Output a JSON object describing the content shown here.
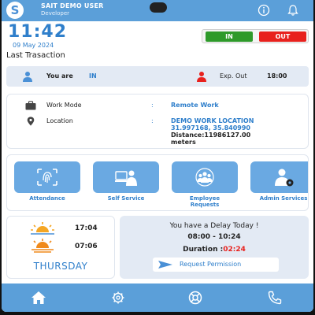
{
  "header": {
    "logo_letter": "S",
    "user_name": "SAIT DEMO USER",
    "user_role": "Developer",
    "icons": [
      "info-icon",
      "bell-icon"
    ]
  },
  "clock": {
    "time": "11:42",
    "date": "09 May 2024",
    "last_transaction_label": "Last Trasaction"
  },
  "punch": {
    "in_label": "IN",
    "out_label": "OUT",
    "in_color": "#2e9a2a",
    "out_color": "#e8211d"
  },
  "status": {
    "you_are_label": "You are",
    "you_are_value": "IN",
    "exp_out_label": "Exp. Out",
    "exp_out_value": "18:00"
  },
  "work": {
    "work_mode_label": "Work Mode",
    "work_mode_value": "Remote Work",
    "location_label": "Location",
    "colon": ":",
    "location_name": "DEMO WORK LOCATION",
    "location_coords": "31.997168, 35.840990",
    "distance": "Distance:11986127.00",
    "distance_unit": "meters"
  },
  "services": [
    {
      "label": "Attendance",
      "icon": "fingerprint-icon"
    },
    {
      "label": "Self Service",
      "icon": "self-service-icon"
    },
    {
      "label_line1": "Employee",
      "label_line2": "Requests",
      "icon": "employee-requests-icon"
    },
    {
      "label": "Admin Services",
      "icon": "admin-services-icon"
    }
  ],
  "sun": {
    "sunrise_time": "17:04",
    "sunset_time": "07:06",
    "day": "THURSDAY"
  },
  "delay": {
    "title": "You have a Delay Today !",
    "range": "08:00 - 10:24",
    "duration_label": "Duration :",
    "duration_value": "02:24",
    "request_button": "Request Permission"
  },
  "nav": [
    "home-icon",
    "settings-icon",
    "support-icon",
    "phone-icon"
  ],
  "colors": {
    "brand": "#5b9fd9",
    "accent_text": "#2f7fcb",
    "tile": "#6aa9e2",
    "panel": "#e3eaf4"
  }
}
